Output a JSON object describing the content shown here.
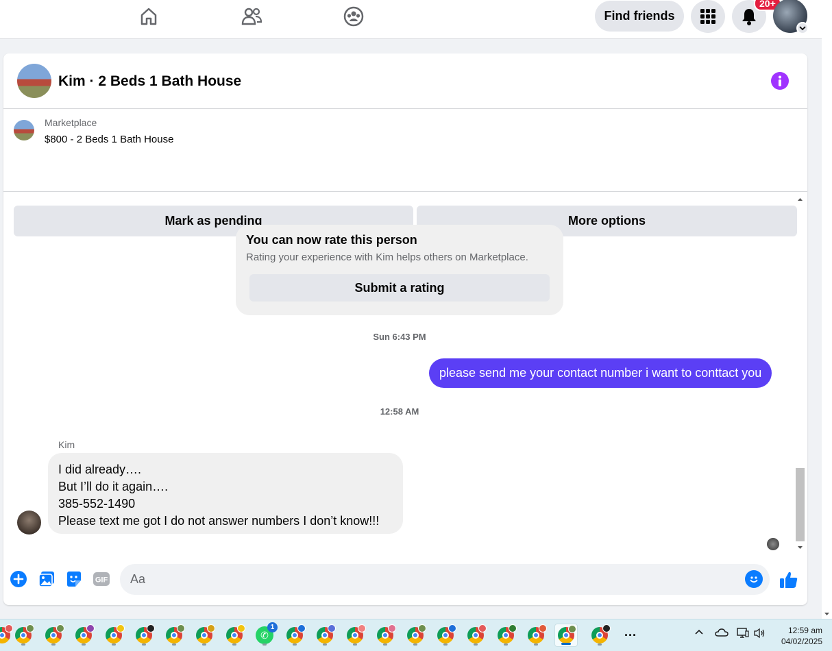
{
  "top_nav": {
    "find_friends_label": "Find friends",
    "notification_badge": "20+"
  },
  "chat": {
    "title": "Kim · 2 Beds 1 Bath House",
    "listing": {
      "source": "Marketplace",
      "title": "$800 - 2 Beds 1 Bath House",
      "mark_pending_label": "Mark as pending",
      "more_options_label": "More options"
    },
    "rating_card": {
      "title": "You can now rate this person",
      "subtitle": "Rating your experience with Kim helps others on Marketplace.",
      "button_label": "Submit a rating"
    },
    "messages": [
      {
        "timestamp": "Sun 6:43 PM",
        "direction": "outgoing",
        "text": "please send me your contact number i want to conttact you"
      },
      {
        "timestamp": "12:58 AM",
        "direction": "incoming",
        "sender": "Kim",
        "lines": [
          "I did already….",
          "But I’ll do it again….",
          "385-552-1490",
          "Please text me got I do not answer numbers I don’t know!!!"
        ]
      }
    ],
    "composer": {
      "placeholder": "Aa",
      "gif_label": "GIF"
    }
  },
  "taskbar": {
    "whatsapp_badge": "1",
    "overflow_label": "···",
    "clock_time": "12:59 am",
    "clock_date": "04/02/2025"
  },
  "colors": {
    "accent_blue": "#0a7cff",
    "outgoing_bubble": "#5b3ff5",
    "info_purple": "#a033ff",
    "badge_red": "#e41e3f"
  }
}
